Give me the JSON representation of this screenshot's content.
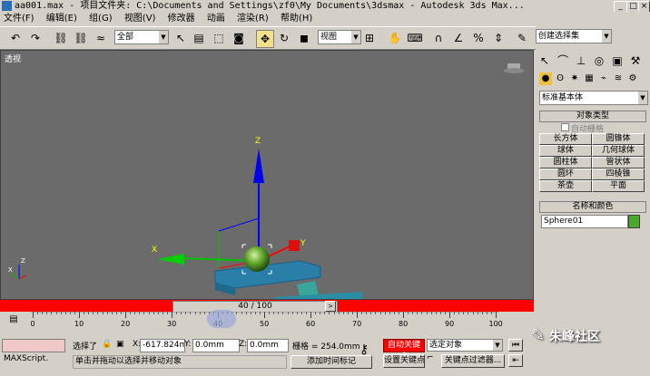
{
  "window": {
    "title": "aa001.max   - 项目文件夹: C:\\Documents and Settings\\zf0\\My Documents\\3dsmax   - Autodesk 3ds Max..."
  },
  "menu": [
    "文件(F)",
    "编辑(E)",
    "组(G)",
    "视图(V)",
    "修改器",
    "动画",
    "渲染(R)",
    "帮助(H)"
  ],
  "toolbar": {
    "selection_filter": "全部",
    "ref_coord": "视图",
    "named_selection": "创建选择集"
  },
  "viewport": {
    "label": "透视",
    "axis_labels": {
      "x": "X",
      "y": "Y",
      "z": "Z"
    }
  },
  "timeline": {
    "time_slider": "40 / 100",
    "ticks": [
      "0",
      "10",
      "20",
      "30",
      "40",
      "50",
      "60",
      "70",
      "80",
      "90",
      "100"
    ]
  },
  "command_panel": {
    "category_dropdown": "标准基本体",
    "object_type_header": "对象类型",
    "autogrid_label": "自动栅格",
    "object_buttons": [
      "长方体",
      "圆锥体",
      "球体",
      "几何球体",
      "圆柱体",
      "管状体",
      "圆环",
      "四棱锥",
      "茶壶",
      "平面"
    ],
    "name_color_header": "名称和颜色",
    "object_name": "Sphere01",
    "object_color": "#4ca82a"
  },
  "status": {
    "maxscript_label": "MAXScript.",
    "selected_label": "选择了",
    "prompt": "单击并拖动以选择并移动对象",
    "x_label": "X:",
    "x_value": "-617.824m",
    "y_label": "Y:",
    "y_value": "0.0mm",
    "z_label": "Z:",
    "z_value": "0.0mm",
    "grid": "栅格 = 254.0mm",
    "add_time_tag": "添加时间标记",
    "auto_key": "自动关键点",
    "set_key": "设置关键点",
    "selected_object": "选定对象",
    "key_filters": "关键点过滤器..."
  },
  "watermark": "朱峰社区",
  "colors": {
    "viewport_bg": "#6b6b6b",
    "accent_red": "#ff0000",
    "ui_gray": "#d4d0c8"
  }
}
